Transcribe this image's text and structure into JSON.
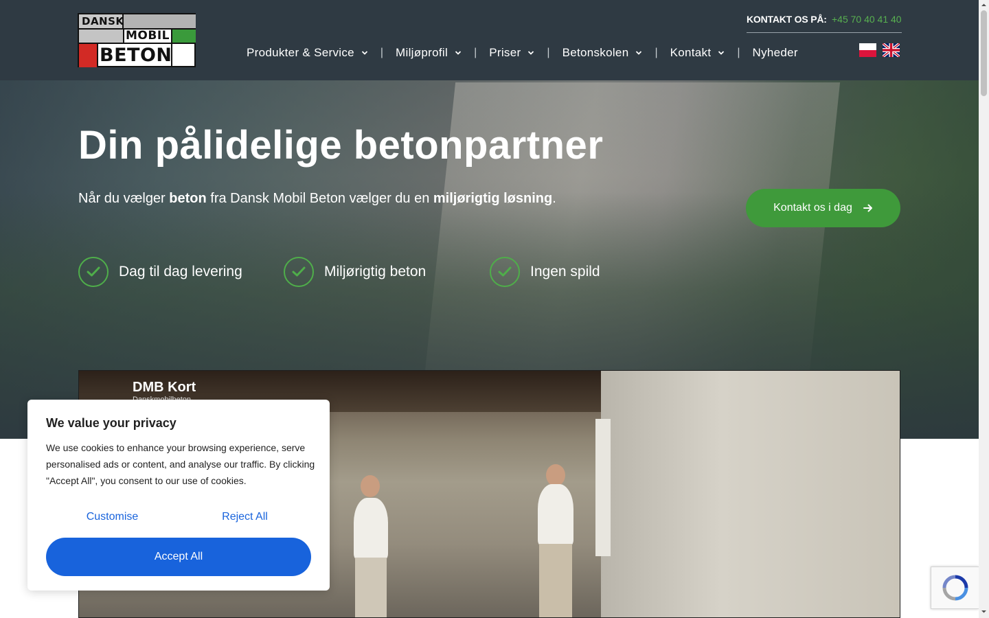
{
  "header": {
    "logo": {
      "line1": "DANSK",
      "line2": "MOBIL",
      "line3": "BETON"
    },
    "contact_label": "KONTAKT OS PÅ:",
    "contact_phone": "+45 70 40 41 40",
    "nav": [
      {
        "label": "Produkter & Service",
        "icon": "chevron-down-icon"
      },
      {
        "label": "Miljøprofil",
        "icon": "chevron-down-icon"
      },
      {
        "label": "Priser",
        "icon": "chevron-down-icon"
      },
      {
        "label": "Betonskolen",
        "icon": "chevron-down-icon"
      },
      {
        "label": "Kontakt",
        "icon": "chevron-down-icon"
      },
      {
        "label": "Nyheder"
      }
    ],
    "separator": "|",
    "languages": [
      "polish-flag-icon",
      "uk-flag-icon"
    ]
  },
  "hero": {
    "title_pre": "Din",
    "title_bold": "pålidelige",
    "title_post": "betonpartner",
    "subtitle": {
      "t1": "Når du vælger ",
      "b1": "beton",
      "t2": " fra Dansk Mobil Beton vælger du en ",
      "b2": "miljørigtig løsning",
      "t3": "."
    },
    "cta_label": "Kontakt os i dag",
    "features": [
      "Dag til dag levering",
      "Miljørigtig beton",
      "Ingen spild"
    ]
  },
  "video": {
    "title": "DMB Kort",
    "channel": "Danskmobilbeton"
  },
  "cookie": {
    "title": "We value your privacy",
    "text": "We use cookies to enhance your browsing experience, serve personalised ads or content, and analyse our traffic. By clicking \"Accept All\", you consent to our use of cookies.",
    "customise": "Customise",
    "reject": "Reject All",
    "accept": "Accept All"
  },
  "colors": {
    "header_bg": "#2f3a43",
    "accent_green": "#3f9a3b",
    "phone_green": "#58b150",
    "cookie_blue": "#1863dc"
  }
}
